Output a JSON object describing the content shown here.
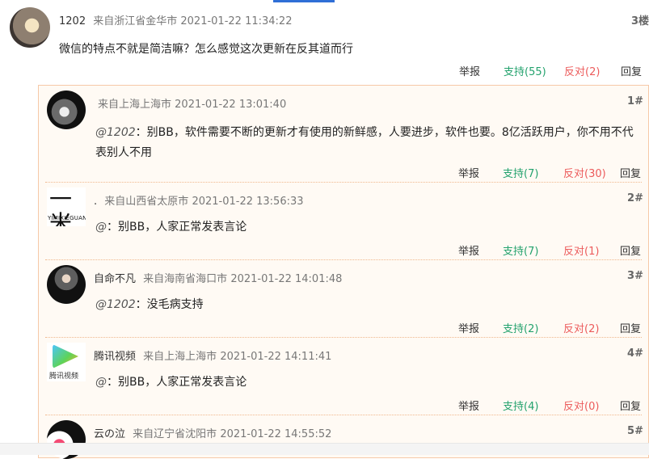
{
  "main": {
    "user": "1202",
    "location": "来自浙江省金华市",
    "time": "2021-01-22 11:34:22",
    "floor": "3楼",
    "text": "微信的特点不就是简洁嘛？怎么感觉这次更新在反其道而行",
    "actions": {
      "report": "举报",
      "support": "支持(55)",
      "oppose": "反对(2)",
      "reply": "回复"
    }
  },
  "replies": [
    {
      "user": "",
      "location": "来自上海上海市",
      "time": "2021-01-22 13:01:40",
      "floor": "1#",
      "mention": "@1202",
      "text": "：别BB，软件需要不断的更新才有使用的新鲜感，人要进步，软件也要。8亿活跃用户，你不用不代表别人不用",
      "actions": {
        "report": "举报",
        "support": "支持(7)",
        "oppose": "反对(30)",
        "reply": "回复"
      }
    },
    {
      "user": ".",
      "location": "来自山西省太原市",
      "time": "2021-01-22 13:56:33",
      "floor": "2#",
      "mention": "@",
      "text": "：别BB，人家正常发表言论",
      "avatar_text": "一米",
      "avatar_sub": "YIMIXIEGUAN",
      "actions": {
        "report": "举报",
        "support": "支持(7)",
        "oppose": "反对(1)",
        "reply": "回复"
      }
    },
    {
      "user": "自命不凡",
      "location": "来自海南省海口市",
      "time": "2021-01-22 14:01:48",
      "floor": "3#",
      "mention": "@1202",
      "text": "：没毛病支持",
      "actions": {
        "report": "举报",
        "support": "支持(2)",
        "oppose": "反对(2)",
        "reply": "回复"
      }
    },
    {
      "user": "腾讯视频",
      "location": "来自上海上海市",
      "time": "2021-01-22 14:11:41",
      "floor": "4#",
      "mention": "@",
      "text": "：别BB，人家正常发表言论",
      "avatar_text": "腾讯视频",
      "actions": {
        "report": "举报",
        "support": "支持(4)",
        "oppose": "反对(0)",
        "reply": "回复"
      }
    },
    {
      "user": "云の泣",
      "location": "来自辽宁省沈阳市",
      "time": "2021-01-22 14:55:52",
      "floor": "5#"
    }
  ]
}
